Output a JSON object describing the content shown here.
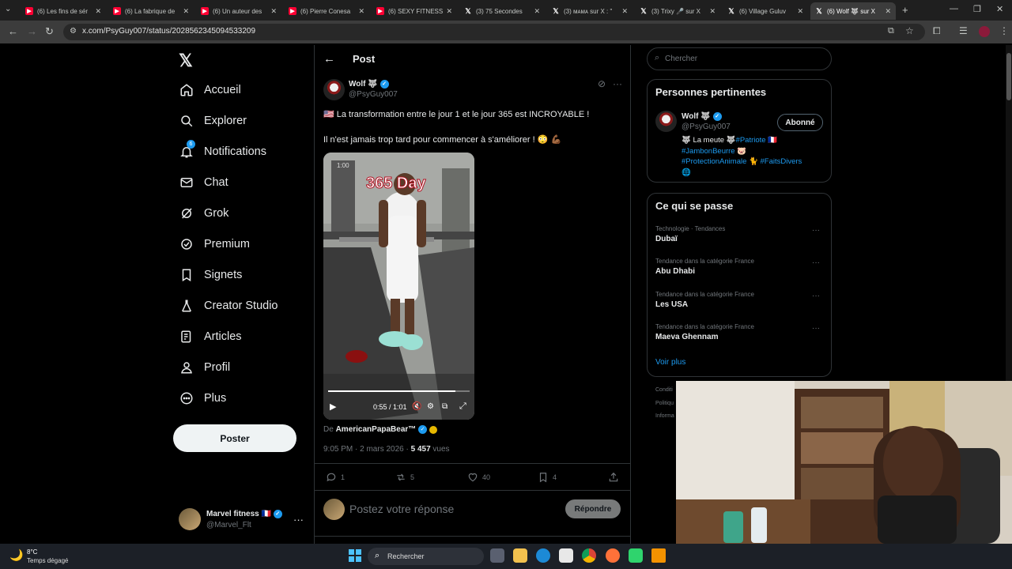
{
  "browser": {
    "tabs": [
      {
        "title": "(6) Les fins de sér",
        "icon": "youtube-icon"
      },
      {
        "title": "(6) La fabrique de",
        "icon": "youtube-icon"
      },
      {
        "title": "(6) Un auteur des",
        "icon": "youtube-icon"
      },
      {
        "title": "(6) Pierre Conesa",
        "icon": "youtube-icon"
      },
      {
        "title": "(6) SEXY FITNESS",
        "icon": "youtube-icon"
      },
      {
        "title": "(3) 75 Secondes",
        "icon": "x-icon"
      },
      {
        "title": "(3) ᴍᴀᴍᴀ sur X : \"",
        "icon": "x-icon"
      },
      {
        "title": "(3) Trixy 🎤 sur X",
        "icon": "x-icon"
      },
      {
        "title": "(6) Village Guluv",
        "icon": "x-icon"
      },
      {
        "title": "(6) Wolf 🐺 sur X",
        "icon": "x-icon",
        "active": true
      }
    ],
    "url": "x.com/PsyGuy007/status/2028562345094533209"
  },
  "nav": {
    "items": [
      {
        "label": "Accueil",
        "icon": "home-icon"
      },
      {
        "label": "Explorer",
        "icon": "search-icon"
      },
      {
        "label": "Notifications",
        "icon": "bell-icon",
        "badge": "6"
      },
      {
        "label": "Chat",
        "icon": "mail-icon"
      },
      {
        "label": "Grok",
        "icon": "grok-icon"
      },
      {
        "label": "Premium",
        "icon": "verified-icon"
      },
      {
        "label": "Signets",
        "icon": "bookmark-icon"
      },
      {
        "label": "Creator Studio",
        "icon": "flask-icon"
      },
      {
        "label": "Articles",
        "icon": "article-icon"
      },
      {
        "label": "Profil",
        "icon": "person-icon"
      },
      {
        "label": "Plus",
        "icon": "more-circle-icon"
      }
    ],
    "post_label": "Poster",
    "account": {
      "name": "Marvel fitness 🇫🇷",
      "handle": "@Marvel_Flt"
    }
  },
  "main": {
    "header": "Post",
    "tweet": {
      "author": "Wolf 🐺",
      "handle": "@PsyGuy007",
      "line1": "🇺🇸 La transformation entre le jour 1 et le jour 365 est INCROYABLE !",
      "line2": "Il n'est jamais trop tard pour commencer à s'améliorer ! 😳 💪🏾",
      "video": {
        "overlay_text": "365 Day",
        "corner_label": "1:00",
        "time": "0:55 / 1:01",
        "progress": 0.9
      },
      "source_prefix": "De",
      "source_name": "AmericanPapaBear™",
      "timestamp": "9:05 PM · 2 mars 2026 · ",
      "views_count": "5 457",
      "views_label": " vues",
      "replies": "1",
      "reposts": "5",
      "likes": "40",
      "bookmarks": "4"
    },
    "reply": {
      "placeholder": "Postez votre réponse",
      "button": "Répondre"
    }
  },
  "sidebar": {
    "search_placeholder": "Chercher",
    "relevant": {
      "title": "Personnes pertinentes",
      "name": "Wolf 🐺",
      "handle": "@PsyGuy007",
      "follow_label": "Abonné",
      "bio_line1_a": "🐺 La meute 🐺",
      "bio_line1_b": "#Patriote",
      "bio_line1_c": " 🇫🇷",
      "bio_line2_a": "#JambonBeurre",
      "bio_line2_b": " 🐷",
      "bio_line3_a": "#ProtectionAnimale",
      "bio_line3_b": " 🐈 ",
      "bio_line3_c": "#FaitsDivers",
      "bio_line4": "🌐"
    },
    "trends": {
      "title": "Ce qui se passe",
      "items": [
        {
          "category": "Technologie · Tendances",
          "name": "Dubaï"
        },
        {
          "category": "Tendance dans la catégorie France",
          "name": "Abu Dhabi"
        },
        {
          "category": "Tendance dans la catégorie France",
          "name": "Les USA"
        },
        {
          "category": "Tendance dans la catégorie France",
          "name": "Maeva Ghennam"
        }
      ],
      "more": "Voir plus"
    },
    "footer": [
      "Conditi",
      "Politiqu",
      "Informa"
    ]
  },
  "taskbar": {
    "temp": "8°C",
    "weather": "Temps dégagé",
    "search": "Rechercher"
  }
}
